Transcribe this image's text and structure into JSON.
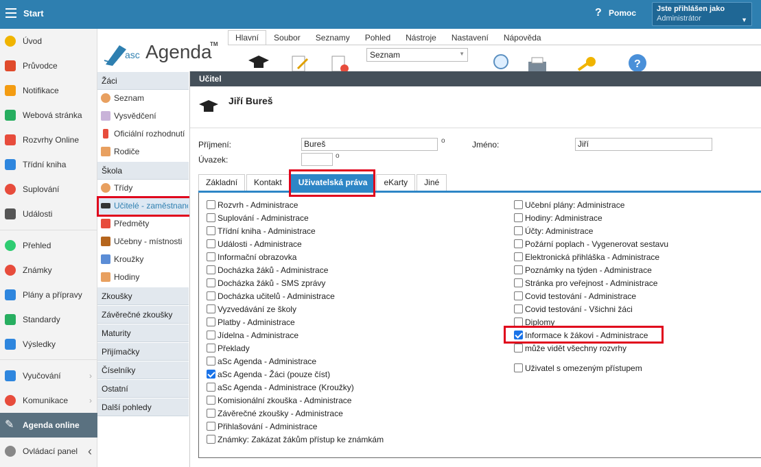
{
  "topbar": {
    "start": "Start",
    "help": "Pomoc",
    "user_line1": "Jste přihlášen jako",
    "user_line2": "Administrátor"
  },
  "sidebar": {
    "items": [
      {
        "label": "Úvod",
        "color": "#f0b400"
      },
      {
        "label": "Průvodce",
        "color": "#e04a2b"
      },
      {
        "label": "Notifikace",
        "color": "#f39c12"
      },
      {
        "label": "Webová stránka",
        "color": "#27ae60"
      },
      {
        "label": "Rozvrhy Online",
        "color": "#e74c3c"
      },
      {
        "label": "Třídní kniha",
        "color": "#2e86de"
      },
      {
        "label": "Suplování",
        "color": "#e74c3c"
      },
      {
        "label": "Události",
        "color": "#555555"
      },
      {
        "label": "Přehled",
        "color": "#2ecc71"
      },
      {
        "label": "Známky",
        "color": "#e74c3c"
      },
      {
        "label": "Plány a přípravy",
        "color": "#2e86de"
      },
      {
        "label": "Standardy",
        "color": "#27ae60"
      },
      {
        "label": "Výsledky",
        "color": "#2e86de"
      },
      {
        "label": "Vyučování",
        "color": "#2e86de"
      },
      {
        "label": "Komunikace",
        "color": "#e74c3c"
      },
      {
        "label": "Agenda online",
        "color": "#ffffff"
      },
      {
        "label": "Ovládací panel",
        "color": "#888888"
      }
    ]
  },
  "logo": {
    "asc": "asc",
    "word": "Agenda",
    "tm": "TM"
  },
  "nav": {
    "zaci": "Žáci",
    "seznam": "Seznam",
    "vysvedceni": "Vysvědčení",
    "oficialni": "Oficiální rozhodnutí",
    "rodice": "Rodiče",
    "skola": "Škola",
    "tridy": "Třídy",
    "ucitele": "Učitelé - zaměstnanci",
    "predmety": "Předměty",
    "ucebny": "Učebny - místnosti",
    "krouzky": "Kroužky",
    "hodiny": "Hodiny",
    "zkousky": "Zkoušky",
    "zaverecne": "Závěrečné zkoušky",
    "maturity": "Maturity",
    "prijimacky": "Přijímačky",
    "ciselniky": "Číselníky",
    "ostatni": "Ostatní",
    "dalsi": "Další pohledy"
  },
  "ribbon": {
    "tabs": [
      "Hlavní",
      "Soubor",
      "Seznamy",
      "Pohled",
      "Nástroje",
      "Nastavení",
      "Nápověda"
    ],
    "select_value": "Seznam"
  },
  "dialog": {
    "title": "Učitel",
    "person": "Jiří Bureš",
    "prijmeni_label": "Příjmení:",
    "prijmeni_value": "Bureš",
    "jmeno_label": "Jméno:",
    "jmeno_value": "Jiří",
    "uvazek_label": "Úvazek:",
    "deg": "o",
    "tabs": [
      "Základní",
      "Kontakt",
      "Uživatelská práva",
      "eKarty",
      "Jiné"
    ]
  },
  "rights_left": [
    {
      "label": "Rozvrh - Administrace",
      "checked": false
    },
    {
      "label": "Suplování - Administrace",
      "checked": false
    },
    {
      "label": "Třídní kniha - Administrace",
      "checked": false
    },
    {
      "label": "Události - Administrace",
      "checked": false
    },
    {
      "label": "Informační obrazovka",
      "checked": false
    },
    {
      "label": "Docházka žáků - Administrace",
      "checked": false
    },
    {
      "label": "Docházka žáků - SMS zprávy",
      "checked": false
    },
    {
      "label": "Docházka učitelů - Administrace",
      "checked": false
    },
    {
      "label": "Vyzvedávání ze školy",
      "checked": false
    },
    {
      "label": "Platby - Administrace",
      "checked": false
    },
    {
      "label": "Jídelna - Administrace",
      "checked": false
    },
    {
      "label": "Překlady",
      "checked": false
    },
    {
      "label": "aSc Agenda - Administrace",
      "checked": false
    },
    {
      "label": "aSc Agenda - Žáci (pouze číst)",
      "checked": true
    },
    {
      "label": "aSc Agenda - Administrace (Kroužky)",
      "checked": false
    },
    {
      "label": "Komisionální zkouška - Administrace",
      "checked": false
    },
    {
      "label": "Závěrečné zkoušky - Administrace",
      "checked": false
    },
    {
      "label": "Přihlašování - Administrace",
      "checked": false
    },
    {
      "label": "Známky: Zakázat žákům přístup ke známkám",
      "checked": false
    }
  ],
  "rights_right": [
    {
      "label": "Učební plány: Administrace",
      "checked": false
    },
    {
      "label": "Hodiny: Administrace",
      "checked": false
    },
    {
      "label": "Účty: Administrace",
      "checked": false
    },
    {
      "label": "Požární poplach - Vygenerovat sestavu",
      "checked": false
    },
    {
      "label": "Elektronická přihláška - Administrace",
      "checked": false
    },
    {
      "label": "Poznámky na týden - Administrace",
      "checked": false
    },
    {
      "label": "Stránka pro veřejnost - Administrace",
      "checked": false
    },
    {
      "label": "Covid testování - Administrace",
      "checked": false
    },
    {
      "label": "Covid testování - Všichni žáci",
      "checked": false
    },
    {
      "label": "Diplomy",
      "checked": false
    },
    {
      "label": "Informace k žákovi - Administrace",
      "checked": true
    },
    {
      "label": "může vidět všechny rozvrhy",
      "checked": false
    },
    {
      "label": "Uživatel s omezeným přístupem",
      "checked": false
    }
  ]
}
